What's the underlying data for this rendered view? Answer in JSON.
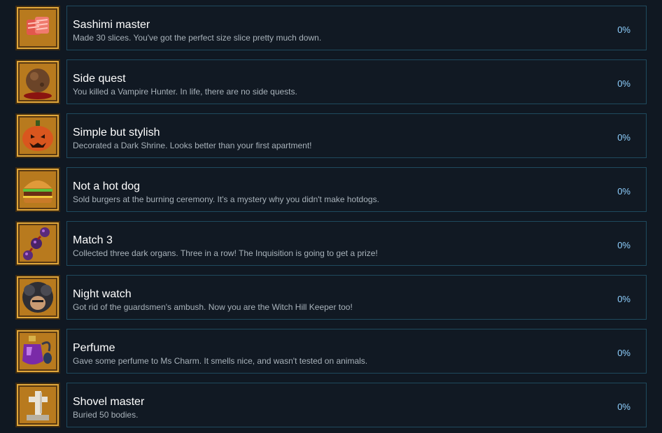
{
  "achievements": [
    {
      "title": "Sashimi master",
      "description": "Made 30 slices. You've got the perfect size slice pretty much down.",
      "progress": "0%",
      "icon": "sashimi-icon"
    },
    {
      "title": "Side quest",
      "description": "You killed a Vampire Hunter. In life, there are no side quests.",
      "progress": "0%",
      "icon": "head-icon"
    },
    {
      "title": "Simple but stylish",
      "description": "Decorated a Dark Shrine. Looks better than your first apartment!",
      "progress": "0%",
      "icon": "pumpkin-icon"
    },
    {
      "title": "Not a hot dog",
      "description": "Sold burgers at the burning ceremony. It's a mystery why you didn't make hotdogs.",
      "progress": "0%",
      "icon": "burger-icon"
    },
    {
      "title": "Match 3",
      "description": "Collected three dark organs. Three in a row! The Inquisition is going to get a prize!",
      "progress": "0%",
      "icon": "dark-organs-icon"
    },
    {
      "title": "Night watch",
      "description": "Got rid of the guardsmen's ambush. Now you are the Witch Hill Keeper too!",
      "progress": "0%",
      "icon": "hooded-guard-icon"
    },
    {
      "title": "Perfume",
      "description": "Gave some perfume to Ms Charm. It smells nice, and wasn't tested on animals.",
      "progress": "0%",
      "icon": "perfume-bottle-icon"
    },
    {
      "title": "Shovel master",
      "description": "Buried 50 bodies.",
      "progress": "0%",
      "icon": "gravestone-icon"
    }
  ]
}
